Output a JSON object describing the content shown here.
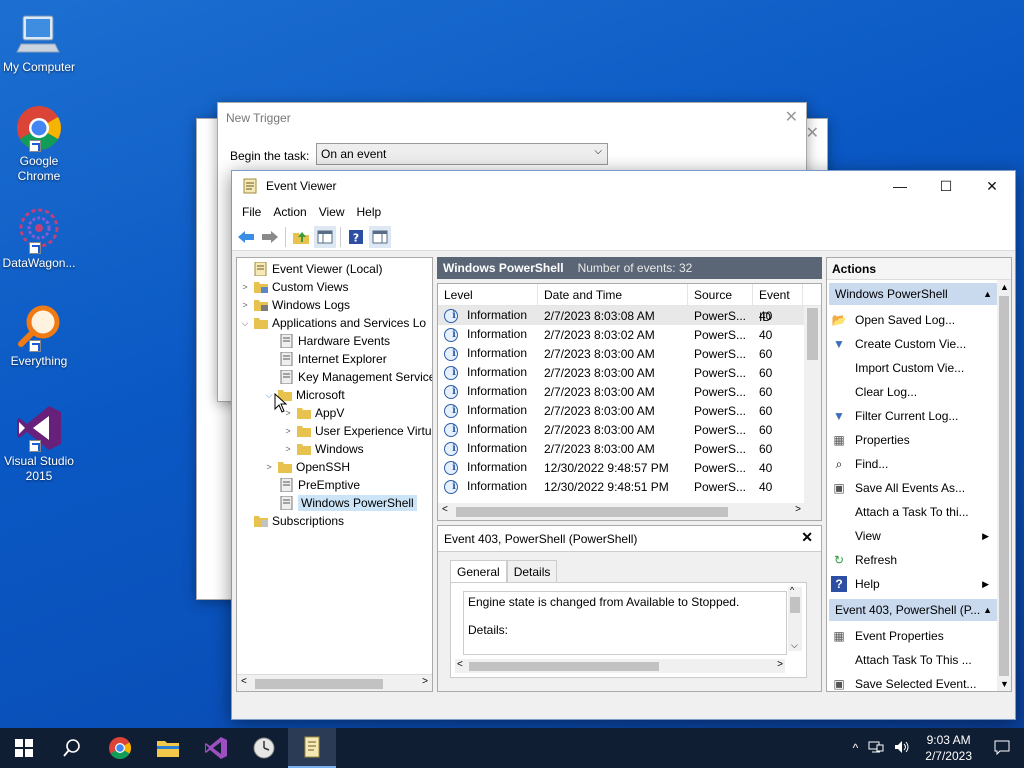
{
  "desktop": {
    "icons": [
      {
        "label": "My Computer"
      },
      {
        "label": "Google Chrome"
      },
      {
        "label": "DataWagon..."
      },
      {
        "label": "Everything"
      },
      {
        "label": "Visual Studio 2015"
      }
    ]
  },
  "bg_dialog": {
    "title": "New Trigger",
    "begin_label": "Begin the task:",
    "begin_value": "On an event"
  },
  "event_viewer": {
    "title": "Event Viewer",
    "menu": [
      "File",
      "Action",
      "View",
      "Help"
    ],
    "tree": {
      "root": "Event Viewer (Local)",
      "custom_views": "Custom Views",
      "windows_logs": "Windows Logs",
      "apps_services": "Applications and Services Lo",
      "hardware_events": "Hardware Events",
      "internet_explorer": "Internet Explorer",
      "key_management": "Key Management Service",
      "microsoft": "Microsoft",
      "appv": "AppV",
      "user_experience": "User Experience Virtu",
      "windows": "Windows",
      "openssh": "OpenSSH",
      "preemptive": "PreEmptive",
      "windows_powershell": "Windows PowerShell",
      "subscriptions": "Subscriptions"
    },
    "center": {
      "log_name": "Windows PowerShell",
      "event_count": "Number of events: 32",
      "columns": [
        "Level",
        "Date and Time",
        "Source",
        "Event ID"
      ],
      "rows": [
        {
          "level": "Information",
          "date": "2/7/2023 8:03:08 AM",
          "source": "PowerS...",
          "id": "40"
        },
        {
          "level": "Information",
          "date": "2/7/2023 8:03:02 AM",
          "source": "PowerS...",
          "id": "40"
        },
        {
          "level": "Information",
          "date": "2/7/2023 8:03:00 AM",
          "source": "PowerS...",
          "id": "60"
        },
        {
          "level": "Information",
          "date": "2/7/2023 8:03:00 AM",
          "source": "PowerS...",
          "id": "60"
        },
        {
          "level": "Information",
          "date": "2/7/2023 8:03:00 AM",
          "source": "PowerS...",
          "id": "60"
        },
        {
          "level": "Information",
          "date": "2/7/2023 8:03:00 AM",
          "source": "PowerS...",
          "id": "60"
        },
        {
          "level": "Information",
          "date": "2/7/2023 8:03:00 AM",
          "source": "PowerS...",
          "id": "60"
        },
        {
          "level": "Information",
          "date": "2/7/2023 8:03:00 AM",
          "source": "PowerS...",
          "id": "60"
        },
        {
          "level": "Information",
          "date": "12/30/2022 9:48:57 PM",
          "source": "PowerS...",
          "id": "40"
        },
        {
          "level": "Information",
          "date": "12/30/2022 9:48:51 PM",
          "source": "PowerS...",
          "id": "40"
        }
      ],
      "detail_title": "Event 403, PowerShell (PowerShell)",
      "tab_general": "General",
      "tab_details": "Details",
      "detail_line1": "Engine state is changed from Available to Stopped.",
      "detail_line2": "Details:"
    },
    "actions": {
      "title": "Actions",
      "section1": "Windows PowerShell",
      "items1": [
        {
          "label": "Open Saved Log..."
        },
        {
          "label": "Create Custom Vie..."
        },
        {
          "label": "Import Custom Vie..."
        },
        {
          "label": "Clear Log..."
        },
        {
          "label": "Filter Current Log..."
        },
        {
          "label": "Properties"
        },
        {
          "label": "Find..."
        },
        {
          "label": "Save All Events As..."
        },
        {
          "label": "Attach a Task To thi..."
        },
        {
          "label": "View"
        },
        {
          "label": "Refresh"
        },
        {
          "label": "Help"
        }
      ],
      "section2": "Event 403, PowerShell (P...",
      "items2": [
        {
          "label": "Event Properties"
        },
        {
          "label": "Attach Task To This ..."
        },
        {
          "label": "Save Selected Event..."
        }
      ]
    }
  },
  "taskbar": {
    "time": "9:03 AM",
    "date": "2/7/2023"
  }
}
